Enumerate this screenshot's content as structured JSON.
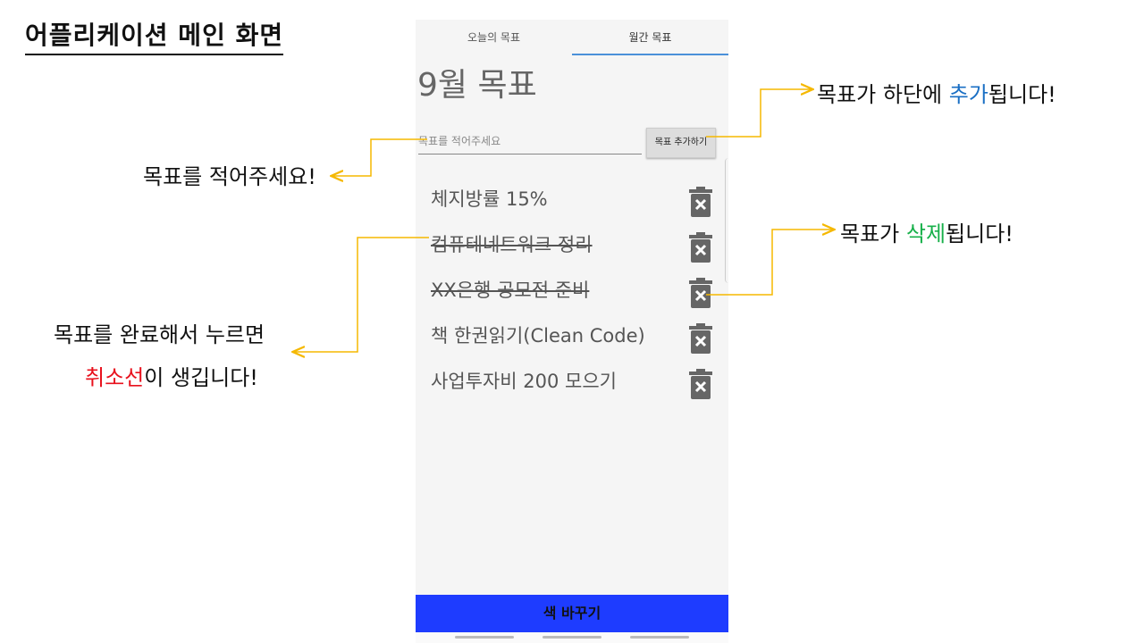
{
  "slide": {
    "title": "어플리케이션 메인 화면"
  },
  "app": {
    "tabs": [
      {
        "label": "오늘의 목표"
      },
      {
        "label": "월간 목표"
      }
    ],
    "active_tab": "월간 목표",
    "month_title": "9월 목표",
    "input": {
      "placeholder": "목표를 적어주세요",
      "value": ""
    },
    "add_button_label": "목표 추가하기",
    "goals": [
      {
        "text": "체지방률 15%",
        "done": false
      },
      {
        "text": "컴퓨테네트워크 정리",
        "done": true
      },
      {
        "text": "XX은행 공모전 준비",
        "done": true
      },
      {
        "text": "책 한권읽기(Clean Code)",
        "done": false
      },
      {
        "text": "사업투자비 200 모으기",
        "done": false
      }
    ],
    "bottom_button_label": "색 바꾸기",
    "colors": {
      "accent_blue": "#1e3cff",
      "tab_indicator": "#4a90d9"
    }
  },
  "annotations": {
    "write_goal": "목표를 적어주세요!",
    "add_goal_pre": "목표가 하단에 ",
    "add_goal_hl": "추가",
    "add_goal_post": "됩니다!",
    "delete_goal_pre": "목표가 ",
    "delete_goal_hl": "삭제",
    "delete_goal_post": "됩니다!",
    "complete_line1": "목표를 완료해서 누르면",
    "complete_line2_hl": "취소선",
    "complete_line2_post": "이 생깁니다!",
    "arrow_color": "#f5b800"
  }
}
